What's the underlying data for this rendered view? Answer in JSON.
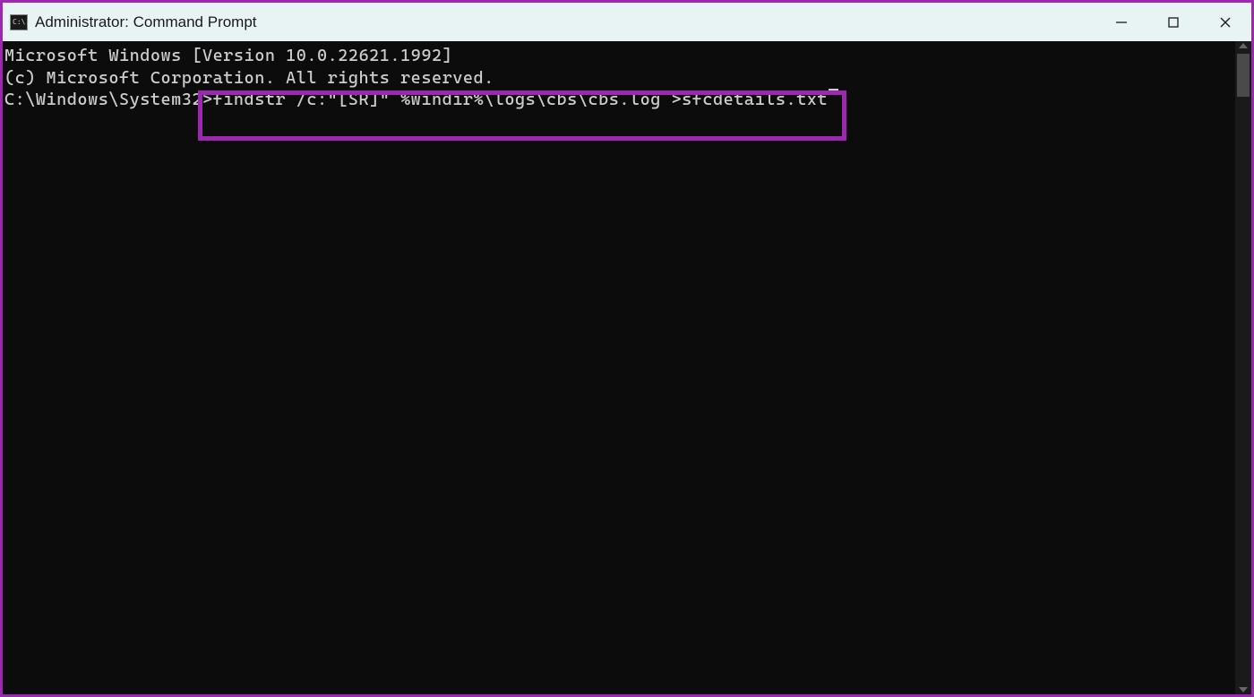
{
  "titlebar": {
    "icon_label": "C:\\.",
    "title": "Administrator: Command Prompt"
  },
  "terminal": {
    "line1": "Microsoft Windows [Version 10.0.22621.1992]",
    "line2": "(c) Microsoft Corporation. All rights reserved.",
    "blank": "",
    "prompt": "C:\\Windows\\System32>",
    "command": "findstr /c:\"[SR]\" %windir%\\logs\\cbs\\cbs.log >sfcdetails.txt"
  },
  "colors": {
    "highlight_border": "#9c27b0",
    "titlebar_bg": "#e8f4f3",
    "terminal_bg": "#0c0c0c",
    "terminal_fg": "#cccccc"
  }
}
